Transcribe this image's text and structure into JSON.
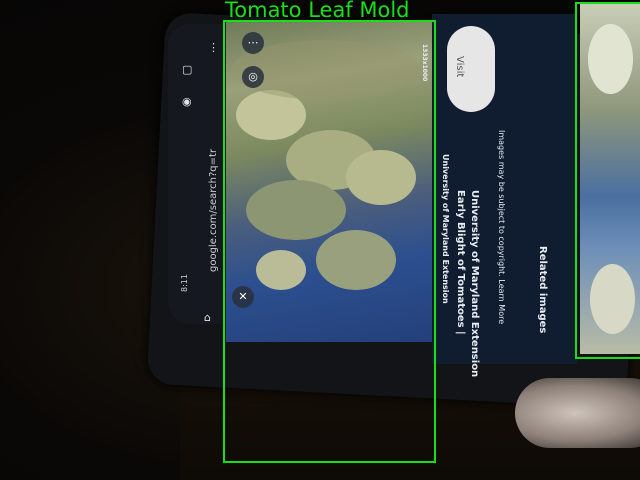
{
  "browser": {
    "time": "8:11",
    "url": "google.com/search?q=tr"
  },
  "image_viewer": {
    "more_icon": "⋯",
    "lens_icon": "◎",
    "close_icon": "✕",
    "dimension_badge": "1333x1000"
  },
  "info_panel": {
    "source": "University of Maryland Extension",
    "title": "Early Blight of Tomatoes |",
    "title_line2": "University of Maryland Extension",
    "copyright": "Images may be subject to copyright. Learn More",
    "related": "Related images",
    "visit_button": "Visit"
  },
  "detections": [
    {
      "label": "Tomato Leaf Mold",
      "color": "#18e018"
    },
    {
      "label": "",
      "color": "#18e018"
    }
  ]
}
